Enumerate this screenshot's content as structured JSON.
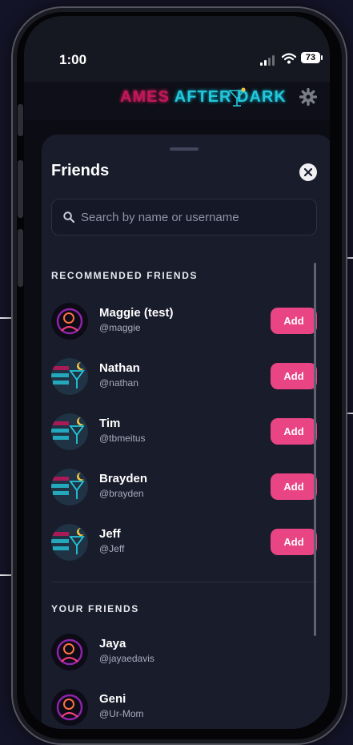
{
  "status_bar": {
    "time": "1:00",
    "battery": "73"
  },
  "app": {
    "logo_part1": "AMES",
    "logo_part2": "AFTER DARK"
  },
  "sheet": {
    "title": "Friends",
    "search_placeholder": "Search by name or username",
    "search_value": ""
  },
  "recommended": {
    "title": "RECOMMENDED FRIENDS",
    "items": [
      {
        "name": "Maggie (test)",
        "username": "@maggie",
        "add_label": "Add",
        "avatar": "neon-portrait"
      },
      {
        "name": "Nathan",
        "username": "@nathan",
        "add_label": "Add",
        "avatar": "ames-logo"
      },
      {
        "name": "Tim",
        "username": "@tbmeitus",
        "add_label": "Add",
        "avatar": "ames-logo"
      },
      {
        "name": "Brayden",
        "username": "@brayden",
        "add_label": "Add",
        "avatar": "ames-logo"
      },
      {
        "name": "Jeff",
        "username": "@Jeff",
        "add_label": "Add",
        "avatar": "ames-logo"
      }
    ]
  },
  "your_friends": {
    "title": "YOUR FRIENDS",
    "items": [
      {
        "name": "Jaya",
        "username": "@jayaedavis",
        "avatar": "neon-portrait"
      },
      {
        "name": "Geni",
        "username": "@Ur-Mom",
        "avatar": "neon-portrait"
      }
    ]
  },
  "colors": {
    "accent": "#e94585",
    "sheet": "#191c2b",
    "background": "#0b0c14"
  },
  "icons": [
    "signal-icon",
    "wifi-icon",
    "battery-icon",
    "gear-icon",
    "close-icon",
    "search-icon"
  ]
}
